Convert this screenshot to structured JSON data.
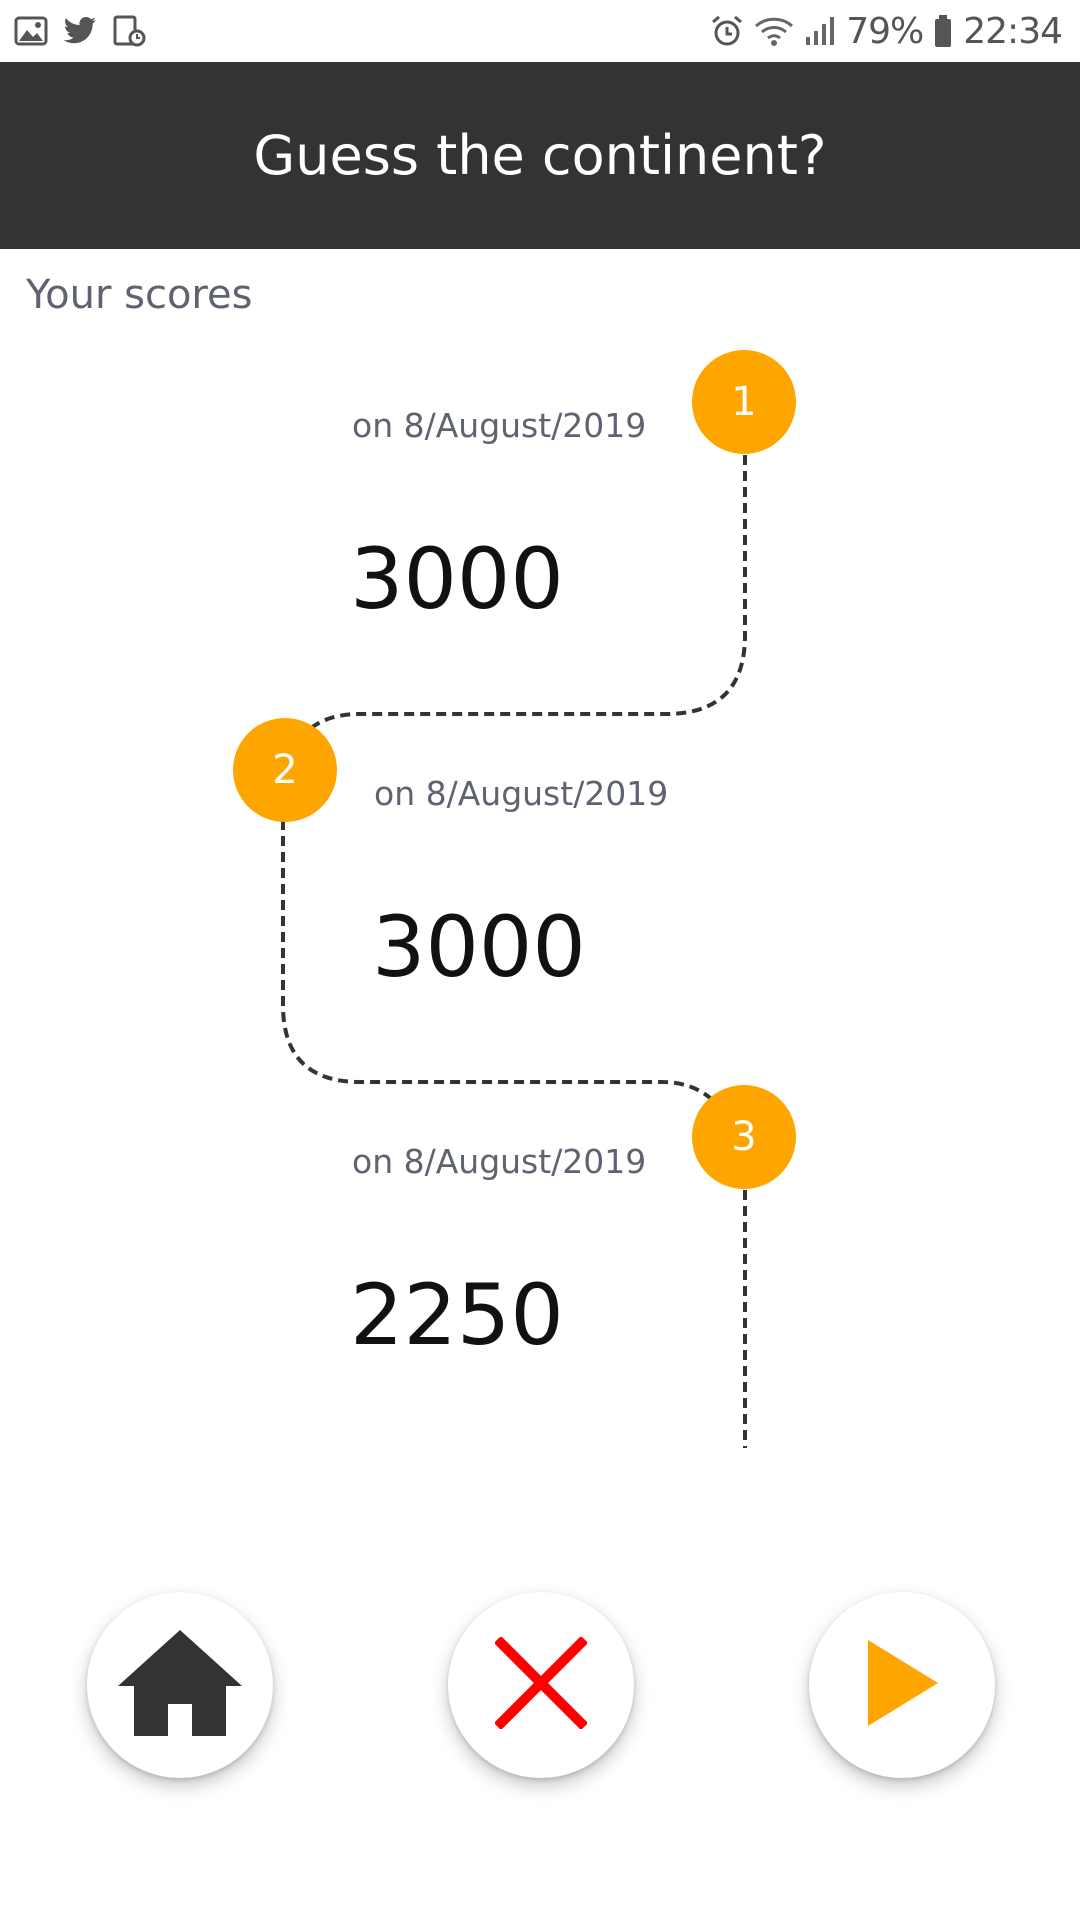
{
  "status_bar": {
    "left_icons": [
      "gallery-icon",
      "twitter-icon",
      "screenshot-icon"
    ],
    "right_icons": [
      "alarm-icon",
      "wifi-icon",
      "signal-icon",
      "battery-icon"
    ],
    "battery": "79%",
    "time": "22:34"
  },
  "app_bar": {
    "title": "Guess the continent?"
  },
  "section": {
    "title": "Your scores"
  },
  "scores": [
    {
      "rank": "1",
      "date": "on 8/August/2019",
      "score": "3000"
    },
    {
      "rank": "2",
      "date": "on 8/August/2019",
      "score": "3000"
    },
    {
      "rank": "3",
      "date": "on 8/August/2019",
      "score": "2250"
    }
  ],
  "buttons": {
    "home": {
      "icon": "home-icon"
    },
    "close": {
      "icon": "close-icon"
    },
    "play": {
      "icon": "play-icon"
    }
  },
  "colors": {
    "app_bar": "#333333",
    "accent": "#ffa500",
    "close": "#ff0000",
    "muted_text": "#5f6270"
  }
}
